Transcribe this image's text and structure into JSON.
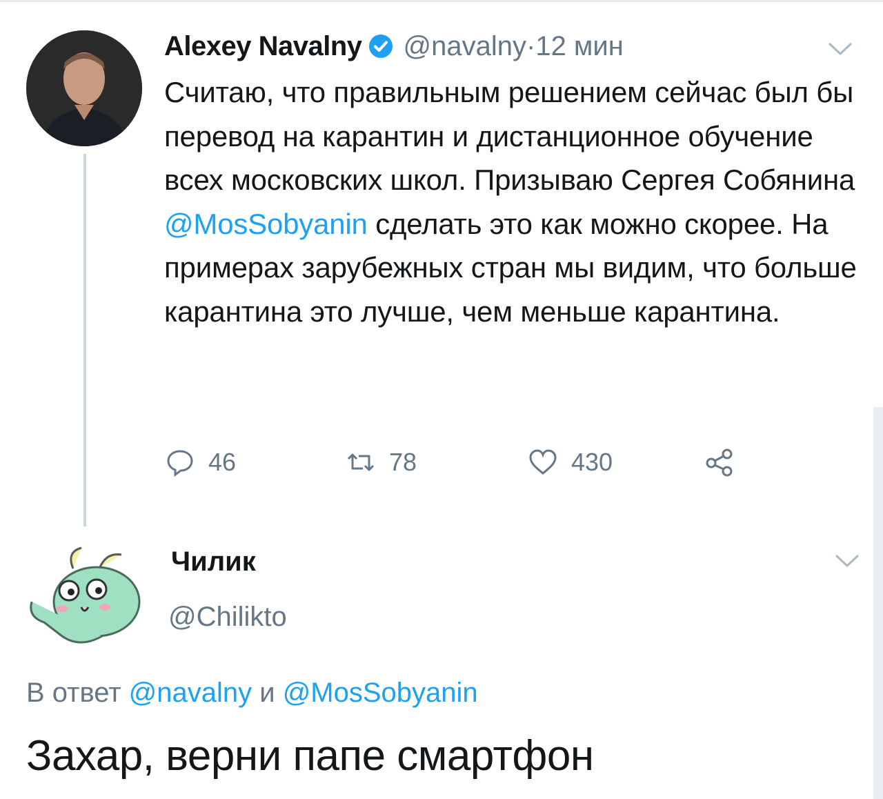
{
  "tweet": {
    "author_name": "Alexey Navalny",
    "author_handle": "@navalny",
    "separator": " · ",
    "time": "12 мин",
    "text_before_mention": "Считаю, что правильным решением сейчас был бы перевод на карантин и дистанционное обучение всех московских школ. Призываю Сергея Собянина ",
    "mention": "@MosSobyanin",
    "text_after_mention": " сделать это как можно скорее. На примерах зарубежных стран мы видим, что больше карантина это лучше, чем меньше карантина.",
    "replies": "46",
    "retweets": "78",
    "likes": "430"
  },
  "reply": {
    "author_name": "Чилик",
    "author_handle": "@Chilikto",
    "reply_to_prefix": "В ответ ",
    "reply_to_user1": "@navalny",
    "reply_to_joiner": " и ",
    "reply_to_user2": "@MosSobyanin",
    "text": "Захар, верни папе смартфон"
  },
  "colors": {
    "accent": "#1da1f2",
    "secondary_text": "#657786",
    "primary_text": "#14171a",
    "thread_line": "#ccd6dd"
  },
  "icons": [
    "verified-badge-icon",
    "chevron-down-icon",
    "reply-icon",
    "retweet-icon",
    "like-icon",
    "share-icon"
  ]
}
